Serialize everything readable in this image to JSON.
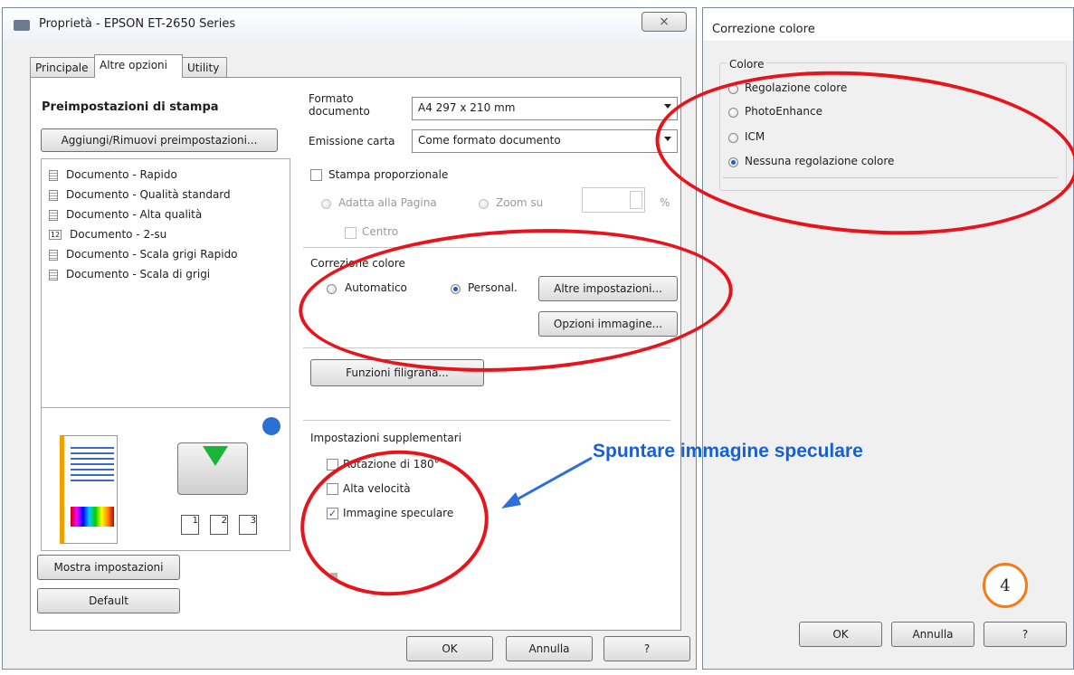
{
  "main_window": {
    "title": "Proprietà - EPSON ET-2650 Series",
    "close_glyph": "⨯",
    "tabs": [
      "Principale",
      "Altre opzioni",
      "Utility"
    ],
    "active_tab": "Altre opzioni",
    "presets": {
      "heading": "Preimpostazioni di stampa",
      "add_remove_button": "Aggiungi/Rimuovi preimpostazioni...",
      "items": [
        "Documento - Rapido",
        "Documento - Qualità standard",
        "Documento - Alta qualità",
        "Documento - 2-su",
        "Documento - Scala grigi Rapido",
        "Documento - Scala di grigi"
      ]
    },
    "paper": {
      "format_label": "Formato documento",
      "format_value": "A4 297 x 210 mm",
      "output_label": "Emissione carta",
      "output_value": "Come formato documento",
      "proportional_label": "Stampa proporzionale",
      "fit_page_label": "Adatta alla Pagina",
      "zoom_label": "Zoom su",
      "percent_symbol": "%",
      "center_label": "Centro"
    },
    "color_correction": {
      "heading": "Correzione colore",
      "auto_label": "Automatico",
      "custom_label": "Personal.",
      "more_settings_button": "Altre impostazioni...",
      "image_options_button": "Opzioni immagine..."
    },
    "watermark_button": "Funzioni filigrana...",
    "extra": {
      "heading": "Impostazioni supplementari",
      "rotate_label": "Rotazione di 180°",
      "high_speed_label": "Alta velocità",
      "mirror_label": "Immagine speculare",
      "mirror_checked": true
    },
    "preview_pages": [
      "1",
      "2",
      "3"
    ],
    "show_settings_button": "Mostra impostazioni",
    "default_button": "Default",
    "ok_button": "OK",
    "cancel_button": "Annulla",
    "help_button": "?"
  },
  "color_window": {
    "title": "Correzione colore",
    "group_label": "Colore",
    "options": [
      "Regolazione colore",
      "PhotoEnhance",
      "ICM",
      "Nessuna regolazione colore"
    ],
    "selected_option": "Nessuna regolazione colore",
    "ok_button": "OK",
    "cancel_button": "Annulla",
    "help_button": "?"
  },
  "annotation": {
    "text": "Spuntare immagine speculare",
    "step_number": "4",
    "text_color": "#1560d6",
    "ellipse_color": "#e8141b",
    "step_circle_color": "#f07d1a"
  }
}
